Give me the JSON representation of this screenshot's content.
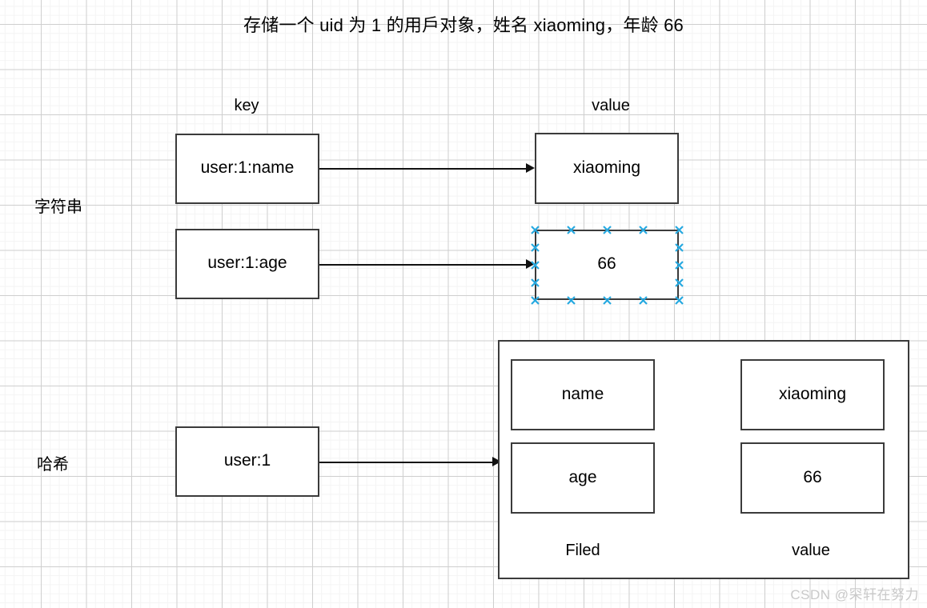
{
  "title": "存储一个 uid 为 1 的用戶对象，姓名 xiaoming，年龄 66",
  "columns": {
    "key_label": "key",
    "value_label": "value"
  },
  "rows": {
    "string_label": "字符串",
    "hash_label": "哈希"
  },
  "string_section": {
    "pairs": [
      {
        "key": "user:1:name",
        "value": "xiaoming",
        "selected": false
      },
      {
        "key": "user:1:age",
        "value": "66",
        "selected": true
      }
    ]
  },
  "hash_section": {
    "key": "user:1",
    "fields": [
      {
        "field": "name",
        "value": "xiaoming"
      },
      {
        "field": "age",
        "value": "66"
      }
    ],
    "field_column_label": "Filed",
    "value_column_label": "value"
  },
  "watermark": "CSDN @罙轩在努力",
  "colors": {
    "box_border": "#3b3b3b",
    "arrow": "#111111",
    "selection_handle": "#26a9e0",
    "grid_major": "#cfcfcf",
    "grid_minor": "#f4f4f4",
    "watermark": "#c9c9c9"
  },
  "selection": {
    "handle_icon": "x-handle-icon",
    "handle_count": 12
  }
}
